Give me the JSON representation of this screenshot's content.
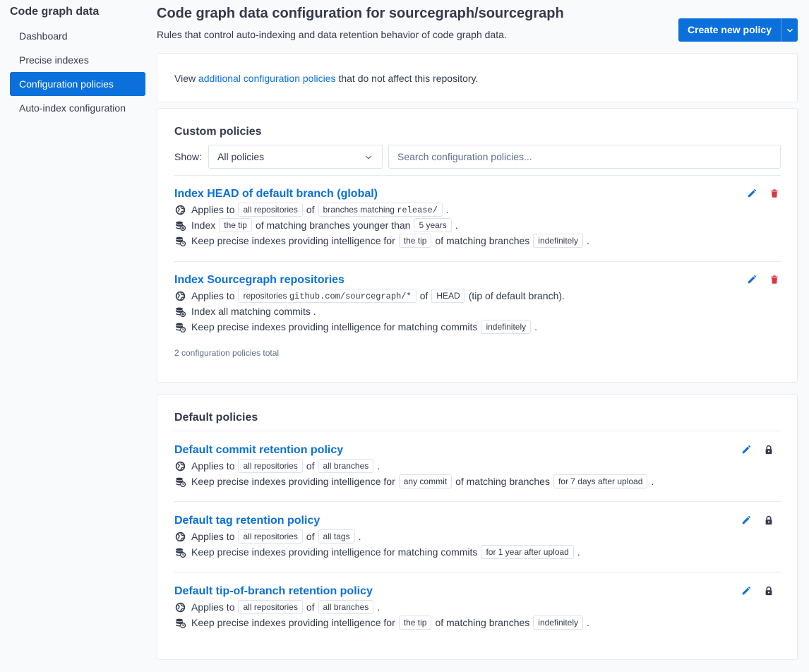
{
  "sidebar": {
    "title": "Code graph data",
    "items": [
      {
        "label": "Dashboard"
      },
      {
        "label": "Precise indexes"
      },
      {
        "label": "Configuration policies"
      },
      {
        "label": "Auto-index configuration"
      }
    ]
  },
  "header": {
    "title": "Code graph data configuration for sourcegraph/sourcegraph",
    "subtitle": "Rules that control auto-indexing and data retention behavior of code graph data.",
    "create_button": "Create new policy"
  },
  "info": {
    "prefix": "View",
    "link": "additional configuration policies",
    "suffix": "that do not affect this repository."
  },
  "custom": {
    "title": "Custom policies",
    "show_label": "Show:",
    "filter_value": "All policies",
    "search_placeholder": "Search configuration policies...",
    "total": "2 configuration policies total",
    "policies": [
      {
        "name": "Index HEAD of default branch (global)",
        "applies_prefix": "Applies to",
        "applies_repo": "all repositories",
        "applies_of": "of",
        "applies_branch_text": "branches matching",
        "applies_branch_code": "release/",
        "applies_end": ".",
        "index_prefix": "Index",
        "index_badge": "the tip",
        "index_mid": "of matching branches younger than",
        "index_age": "5 years",
        "index_end": ".",
        "keep_prefix": "Keep precise indexes providing intelligence for",
        "keep_badge": "the tip",
        "keep_mid": "of matching branches",
        "keep_duration": "indefinitely",
        "keep_end": "."
      },
      {
        "name": "Index Sourcegraph repositories",
        "applies_prefix": "Applies to",
        "applies_repo_text": "repositories",
        "applies_repo_code": "github.com/sourcegraph/*",
        "applies_of": "of",
        "applies_branch": "HEAD",
        "applies_end": "(tip of default branch).",
        "index_text": "Index all matching commits .",
        "keep_prefix": "Keep precise indexes providing intelligence for matching commits",
        "keep_duration": "indefinitely",
        "keep_end": "."
      }
    ]
  },
  "default": {
    "title": "Default policies",
    "policies": [
      {
        "name": "Default commit retention policy",
        "applies_prefix": "Applies to",
        "applies_repo": "all repositories",
        "applies_of": "of",
        "applies_branch": "all branches",
        "applies_end": ".",
        "keep_prefix": "Keep precise indexes providing intelligence for",
        "keep_badge": "any commit",
        "keep_mid": "of matching branches",
        "keep_duration": "for 7 days after upload",
        "keep_end": "."
      },
      {
        "name": "Default tag retention policy",
        "applies_prefix": "Applies to",
        "applies_repo": "all repositories",
        "applies_of": "of",
        "applies_branch": "all tags",
        "applies_end": ".",
        "keep_prefix": "Keep precise indexes providing intelligence for matching commits",
        "keep_duration": "for 1 year after upload",
        "keep_end": "."
      },
      {
        "name": "Default tip-of-branch retention policy",
        "applies_prefix": "Applies to",
        "applies_repo": "all repositories",
        "applies_of": "of",
        "applies_branch": "all branches",
        "applies_end": ".",
        "keep_prefix": "Keep precise indexes providing intelligence for",
        "keep_badge": "the tip",
        "keep_mid": "of matching branches",
        "keep_duration": "indefinitely",
        "keep_end": "."
      }
    ]
  },
  "colors": {
    "accent": "#0b70db",
    "danger": "#dc3545",
    "text": "#343a4d",
    "muted": "#5e6e8c",
    "border": "#e6ebf2"
  },
  "icons": {
    "applies": "globe-icon",
    "index": "database-plus-icon",
    "retention": "database-clock-icon",
    "edit": "pencil-icon",
    "delete": "trash-icon",
    "locked": "lock-icon"
  }
}
